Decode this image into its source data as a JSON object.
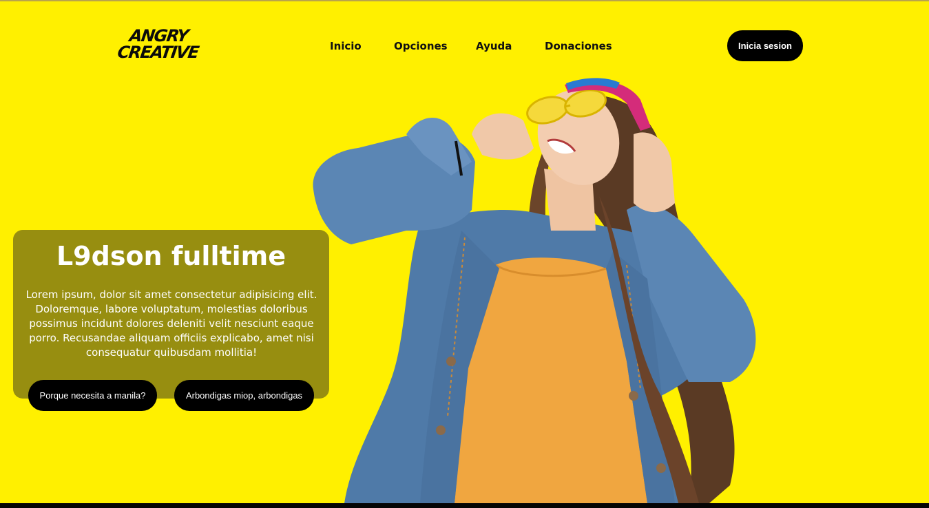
{
  "brand": {
    "logo_line1": "ANGRY",
    "logo_line2": "CREATIVE"
  },
  "nav": {
    "items": [
      {
        "label": "Inicio"
      },
      {
        "label": "Opciones"
      },
      {
        "label": "Ayuda"
      },
      {
        "label": "Donaciones"
      }
    ],
    "login_label": "Inicia sesion"
  },
  "hero": {
    "title": "L9dson fulltime",
    "text": "Lorem ipsum, dolor sit amet consectetur adipisicing elit. Doloremque, labore voluptatum, molestias doloribus possimus incidunt dolores deleniti velit nesciunt eaque porro. Recusandae aliquam officiis explicabo, amet nisi consequatur quibusdam mollitia!",
    "buttons": [
      {
        "label": "Porque necesita a manila?"
      },
      {
        "label": "Arbondigas miop, arbondigas"
      }
    ]
  },
  "colors": {
    "background": "#fff000",
    "card": "#807814",
    "button": "#000000",
    "button_text": "#ffffff"
  }
}
